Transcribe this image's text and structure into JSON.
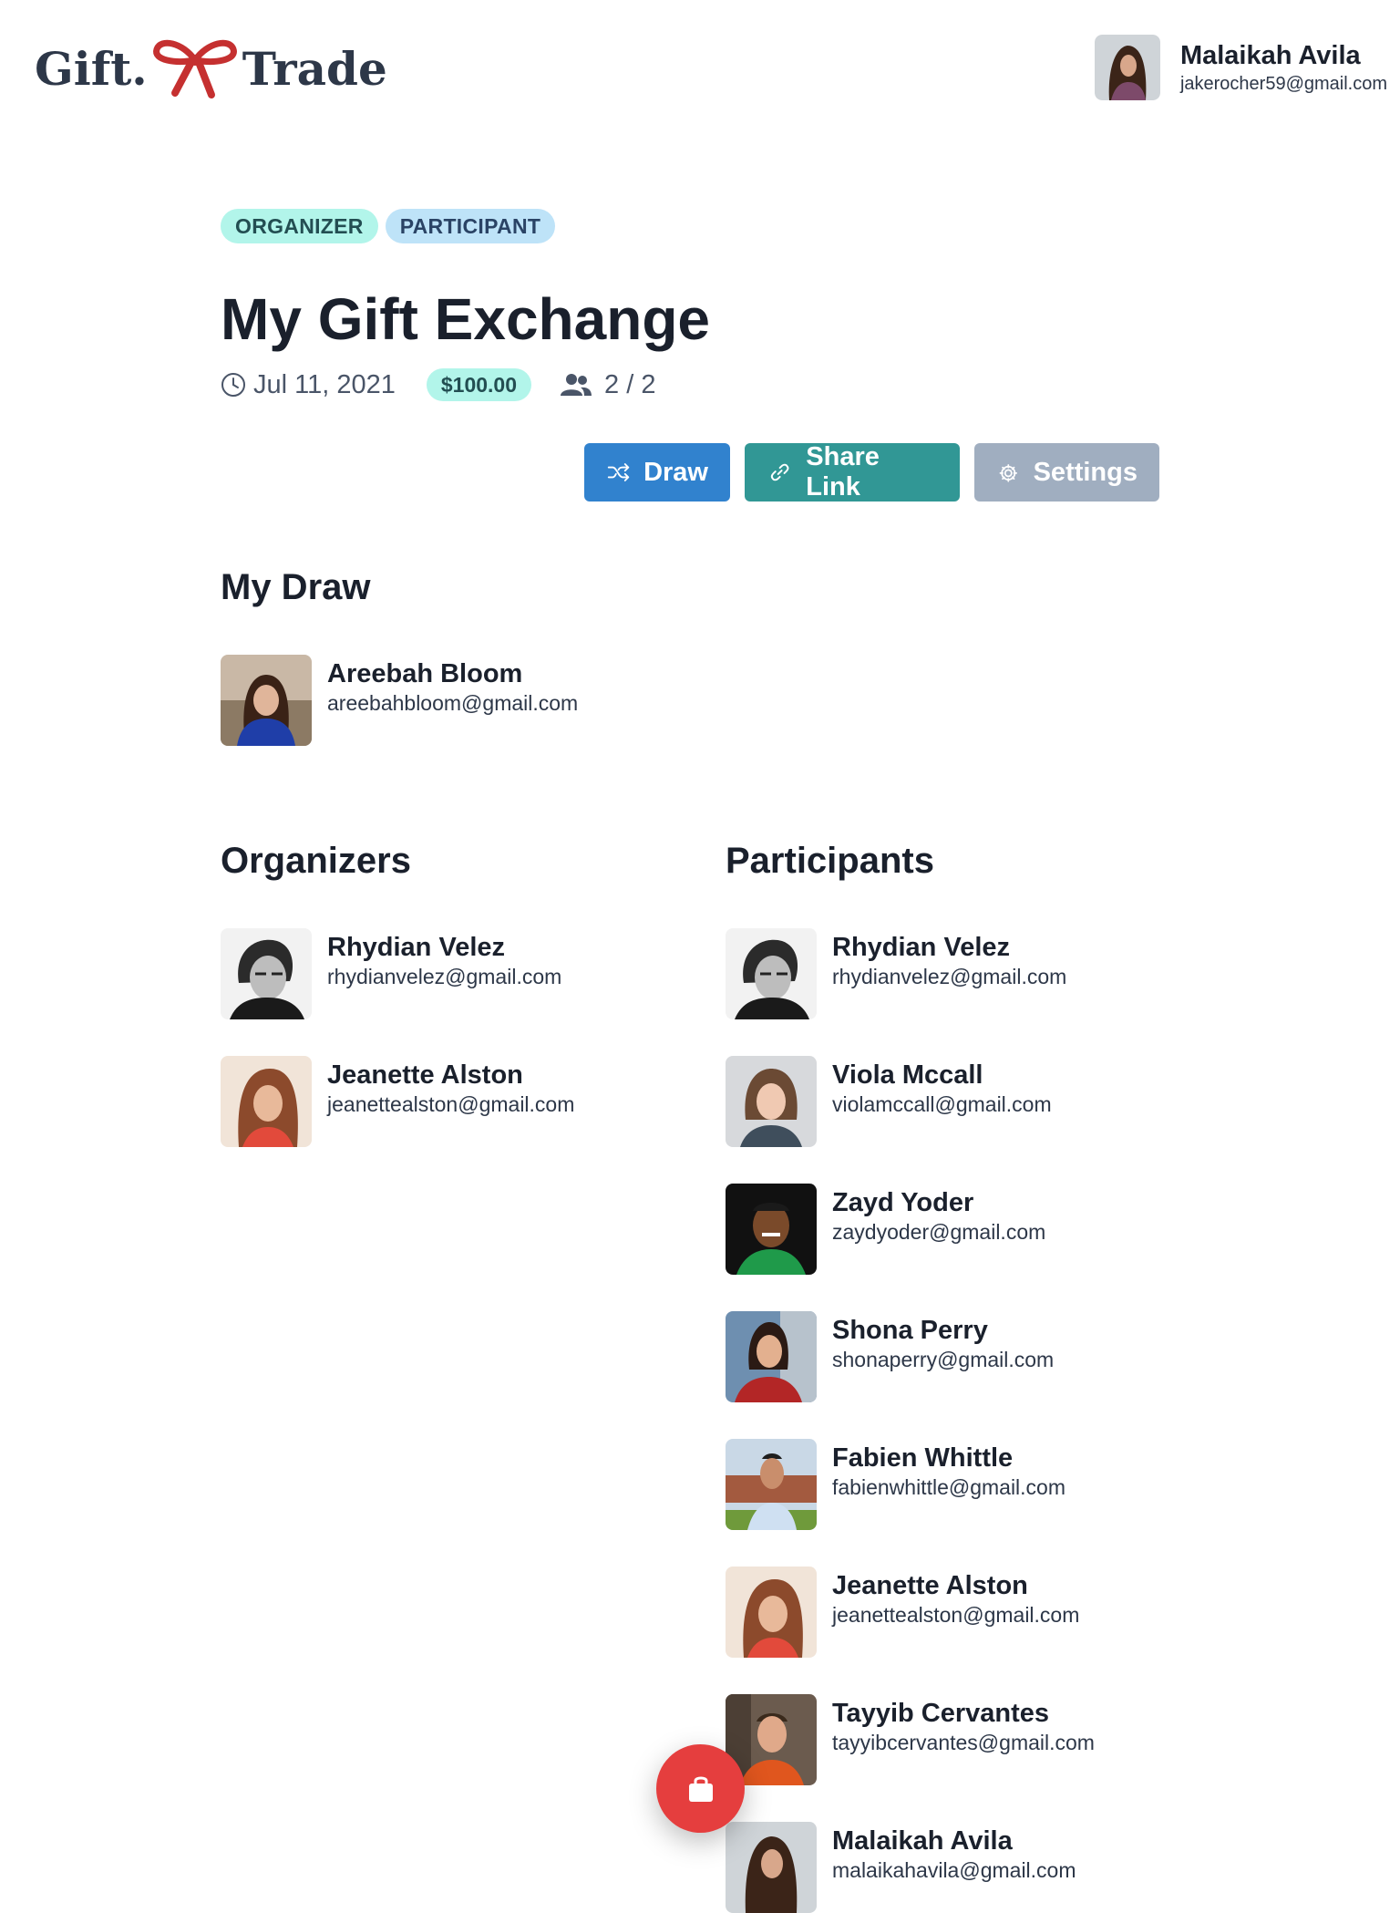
{
  "brand": {
    "left": "Gift.",
    "right": "Trade"
  },
  "user": {
    "name": "Malaikah Avila",
    "email": "jakerocher59@gmail.com"
  },
  "badges": [
    "ORGANIZER",
    "PARTICIPANT"
  ],
  "exchange": {
    "title": "My Gift Exchange",
    "date": "Jul 11, 2021",
    "price": "$100.00",
    "count": "2 / 2"
  },
  "actions": {
    "draw": "Draw",
    "share": "Share Link",
    "settings": "Settings"
  },
  "my_draw": {
    "heading": "My Draw",
    "person": {
      "name": "Areebah Bloom",
      "email": "areebahbloom@gmail.com"
    }
  },
  "organizers": {
    "heading": "Organizers",
    "items": [
      {
        "name": "Rhydian Velez",
        "email": "rhydianvelez@gmail.com"
      },
      {
        "name": "Jeanette Alston",
        "email": "jeanettealston@gmail.com"
      }
    ]
  },
  "participants": {
    "heading": "Participants",
    "items": [
      {
        "name": "Rhydian Velez",
        "email": "rhydianvelez@gmail.com"
      },
      {
        "name": "Viola Mccall",
        "email": "violamccall@gmail.com"
      },
      {
        "name": "Zayd Yoder",
        "email": "zaydyoder@gmail.com"
      },
      {
        "name": "Shona Perry",
        "email": "shonaperry@gmail.com"
      },
      {
        "name": "Fabien Whittle",
        "email": "fabienwhittle@gmail.com"
      },
      {
        "name": "Jeanette Alston",
        "email": "jeanettealston@gmail.com"
      },
      {
        "name": "Tayyib Cervantes",
        "email": "tayyibcervantes@gmail.com"
      },
      {
        "name": "Malaikah Avila",
        "email": "malaikahavila@gmail.com"
      }
    ]
  },
  "colors": {
    "accent_blue": "#3182ce",
    "accent_teal": "#319795",
    "muted": "#a0aec0",
    "fab_red": "#e53e3e",
    "bow_red": "#c53030"
  },
  "icons": [
    "clock-icon",
    "people-icon",
    "shuffle-icon",
    "link-icon",
    "gear-icon",
    "shopping-bag-icon",
    "bow-icon"
  ]
}
